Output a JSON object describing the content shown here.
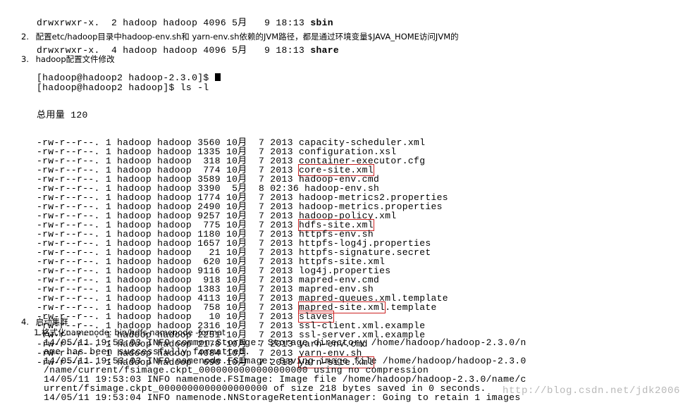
{
  "top_terminal": {
    "lines": [
      {
        "text": "drwxrwxr-x.  2 hadoop hadoop 4096 5月   9 18:13 ",
        "name": "sbin"
      },
      {
        "text": "drwxrwxr-x.  4 hadoop hadoop 4096 5月   9 18:13 ",
        "name": "share"
      }
    ],
    "prompt": "[hadoop@hadoop2 hadoop-2.3.0]$ "
  },
  "step2": {
    "number": "2.",
    "text": "配置etc/hadoop目录中hadoop-env.sh和 yarn-env.sh依赖的JVM路径，都是通过环境变量$JAVA_HOME访问JVM的"
  },
  "step3": {
    "number": "3.",
    "title": "hadoop配置文件修改",
    "prompt": "[hadoop@hadoop2 hadoop]$ ls -l",
    "total": "总用量 120",
    "files": [
      {
        "perm": "-rw-r--r--. 1 hadoop hadoop 3560 10月  7 2013 ",
        "name": "capacity-scheduler.xml",
        "suffix": ""
      },
      {
        "perm": "-rw-r--r--. 1 hadoop hadoop 1335 10月  7 2013 ",
        "name": "configuration.xsl",
        "suffix": ""
      },
      {
        "perm": "-rw-r--r--. 1 hadoop hadoop  318 10月  7 2013 ",
        "name": "container-executor.cfg",
        "suffix": ""
      },
      {
        "perm": "-rw-r--r--. 1 hadoop hadoop  774 10月  7 2013 ",
        "name": "core-site.xml",
        "suffix": "",
        "highlight": true
      },
      {
        "perm": "-rw-r--r--. 1 hadoop hadoop 3589 10月  7 2013 ",
        "name": "hadoop-env.cmd",
        "suffix": ""
      },
      {
        "perm": "-rw-r--r--. 1 hadoop hadoop 3390  5月  8 02:36 ",
        "name": "hadoop-env.sh",
        "suffix": ""
      },
      {
        "perm": "-rw-r--r--. 1 hadoop hadoop 1774 10月  7 2013 ",
        "name": "hadoop-metrics2.properties",
        "suffix": ""
      },
      {
        "perm": "-rw-r--r--. 1 hadoop hadoop 2490 10月  7 2013 ",
        "name": "hadoop-metrics.properties",
        "suffix": ""
      },
      {
        "perm": "-rw-r--r--. 1 hadoop hadoop 9257 10月  7 2013 ",
        "name": "hadoop-policy.xml",
        "suffix": ""
      },
      {
        "perm": "-rw-r--r--. 1 hadoop hadoop  775 10月  7 2013 ",
        "name": "hdfs-site.xml",
        "suffix": "",
        "highlight": true
      },
      {
        "perm": "-rw-r--r--. 1 hadoop hadoop 1180 10月  7 2013 ",
        "name": "httpfs-env.sh",
        "suffix": ""
      },
      {
        "perm": "-rw-r--r--. 1 hadoop hadoop 1657 10月  7 2013 ",
        "name": "httpfs-log4j.properties",
        "suffix": ""
      },
      {
        "perm": "-rw-r--r--. 1 hadoop hadoop   21 10月  7 2013 ",
        "name": "httpfs-signature.secret",
        "suffix": ""
      },
      {
        "perm": "-rw-r--r--. 1 hadoop hadoop  620 10月  7 2013 ",
        "name": "httpfs-site.xml",
        "suffix": ""
      },
      {
        "perm": "-rw-r--r--. 1 hadoop hadoop 9116 10月  7 2013 ",
        "name": "log4j.properties",
        "suffix": ""
      },
      {
        "perm": "-rw-r--r--. 1 hadoop hadoop  918 10月  7 2013 ",
        "name": "mapred-env.cmd",
        "suffix": ""
      },
      {
        "perm": "-rw-r--r--. 1 hadoop hadoop 1383 10月  7 2013 ",
        "name": "mapred-env.sh",
        "suffix": ""
      },
      {
        "perm": "-rw-r--r--. 1 hadoop hadoop 4113 10月  7 2013 ",
        "name": "mapred-queues.xml.template",
        "suffix": ""
      },
      {
        "perm": "-rw-r--r--. 1 hadoop hadoop  758 10月  7 2013 ",
        "name": "mapred-site.xml",
        "suffix": ".template",
        "highlight": true
      },
      {
        "perm": "-rw-r--r--. 1 hadoop hadoop   10 10月  7 2013 ",
        "name": "slaves",
        "suffix": "",
        "highlight": true
      },
      {
        "perm": "-rw-r--r--. 1 hadoop hadoop 2316 10月  7 2013 ",
        "name": "ssl-client.xml.example",
        "suffix": ""
      },
      {
        "perm": "-rw-r--r--. 1 hadoop hadoop 2251 10月  7 2013 ",
        "name": "ssl-server.xml.example",
        "suffix": ""
      },
      {
        "perm": "-rw-r--r--. 1 hadoop hadoop 2178 10月  7 2013 ",
        "name": "yarn-env.cmd",
        "suffix": ""
      },
      {
        "perm": "-rw-r--r--. 1 hadoop hadoop 4084 10月  7 2013 ",
        "name": "yarn-env.sh",
        "suffix": ""
      },
      {
        "perm": "-rw-r--r--. 1 hadoop hadoop  690 10月  7 2013 ",
        "name": "yarn-site.xml",
        "suffix": "",
        "highlight": true
      }
    ]
  },
  "step4": {
    "number": "4.",
    "title": "启动集群",
    "sub": "1.格式化namenode: bin/hdfs namenode -format",
    "log_lines": [
      "14/05/11 19:53:03 INFO common.Storage: Storage directory /home/hadoop/hadoop-2.3.0/n",
      "ame has been successfully formatted.",
      "14/05/11 19:53:03 INFO namenode.FSImage: Saving image file /home/hadoop/hadoop-2.3.0",
      "/name/current/fsimage.ckpt_0000000000000000000 using no compression",
      "14/05/11 19:53:03 INFO namenode.FSImage: Image file /home/hadoop/hadoop-2.3.0/name/c",
      "urrent/fsimage.ckpt_0000000000000000000 of size 218 bytes saved in 0 seconds.",
      "14/05/11 19:53:04 INFO namenode.NNStorageRetentionManager: Going to retain 1 images"
    ]
  },
  "watermark": "http://blog.csdn.net/jdk2006"
}
